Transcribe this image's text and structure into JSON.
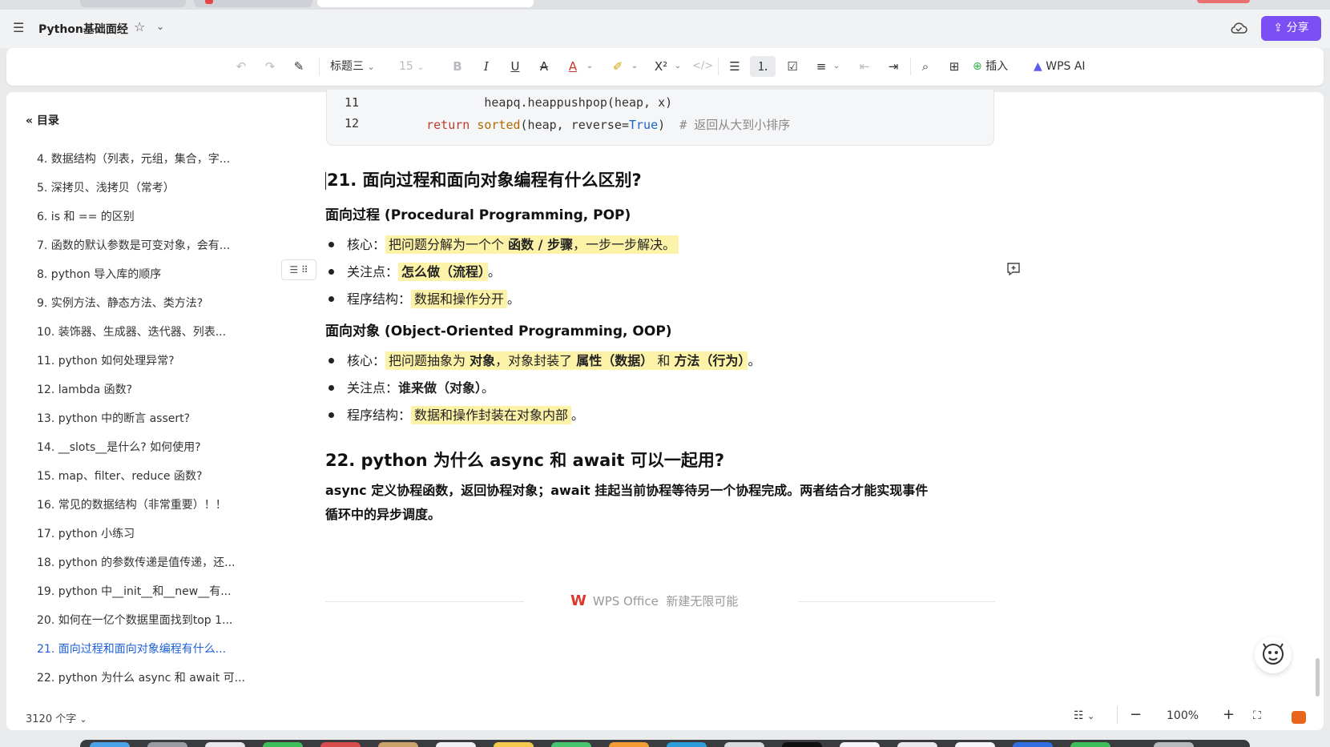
{
  "titlebar": {
    "doc_title": "Python基础面经",
    "share_label": "分享"
  },
  "toolbar": {
    "heading_style": "标题三",
    "font_size": "15",
    "insert_label": "插入",
    "ai_label": "WPS AI"
  },
  "toc": {
    "title": "目录",
    "items": [
      "4.  数据结构（列表，元组，集合，字...",
      "5.  深拷贝、浅拷贝（常考）",
      "6.  is 和 == 的区别",
      "7.  函数的默认参数是可变对象，会有...",
      "8.  python 导入库的顺序",
      "9.  实例方法、静态方法、类方法?",
      "10.  装饰器、生成器、迭代器、列表...",
      "11.  python 如何处理异常?",
      "12.  lambda 函数?",
      "13.  python 中的断言 assert?",
      "14.  __slots__是什么? 如何使用?",
      "15.  map、filter、reduce 函数?",
      "16.  常见的数据结构（非常重要）！！",
      "17.  python 小练习",
      "18.  python 的参数传递是值传递，还...",
      "19.  python 中__init__和__new__有...",
      "20.  如何在一亿个数据里面找到top 1...",
      "21.  面向过程和面向对象编程有什么...",
      "22.  python 为什么 async 和 await 可..."
    ],
    "active_index": 17
  },
  "code": {
    "lines": [
      {
        "num": "11",
        "indent": "            ",
        "parts": [
          [
            "",
            "heapq.heappushpop(heap, x)"
          ]
        ]
      },
      {
        "num": "12",
        "indent": "    ",
        "parts": [
          [
            "kw",
            "return "
          ],
          [
            "fn",
            "sorted"
          ],
          [
            "",
            "(heap, reverse="
          ],
          [
            "bi",
            "True"
          ],
          [
            "",
            ")  "
          ],
          [
            "cm",
            "# 返回从大到小排序"
          ]
        ]
      }
    ]
  },
  "section21": {
    "heading": "21. 面向过程和面向对象编程有什么区别?",
    "pop_title": "面向过程 (Procedural Programming, POP)",
    "pop_core_label": "核心：",
    "pop_core_text": "把问题分解为一个个 ",
    "pop_core_bold": "函数 / 步骤",
    "pop_core_tail": "，一步一步解决。",
    "pop_focus_label": "关注点：",
    "pop_focus_text": "怎么做（流程）",
    "pop_focus_tail": "。",
    "pop_struct_label": "程序结构：",
    "pop_struct_text": "数据和操作分开",
    "pop_struct_tail": "。",
    "oop_title": "面向对象 (Object-Oriented Programming, OOP)",
    "oop_core_label": "核心：",
    "oop_core_pre": "把问题抽象为 ",
    "oop_core_b1": "对象",
    "oop_core_mid": "，对象封装了 ",
    "oop_core_b2": "属性（数据）",
    "oop_core_and": " 和 ",
    "oop_core_b3": "方法（行为）",
    "oop_core_tail": "。",
    "oop_focus_label": "关注点：",
    "oop_focus_text": "谁来做（对象）",
    "oop_focus_tail": "。",
    "oop_struct_label": "程序结构：",
    "oop_struct_text": "数据和操作封装在对象内部",
    "oop_struct_tail": "。"
  },
  "section22": {
    "heading": "22. python 为什么 async 和 await 可以一起用?",
    "para_line1": "async 定义协程函数，返回协程对象；await 挂起当前协程等待另一个协程完成。两者结合才能实现事件",
    "para_line2": "循环中的异步调度。"
  },
  "footer": {
    "brand_logo": "W",
    "brand_name": "WPS Office",
    "brand_slogan": "新建无限可能"
  },
  "status": {
    "word_count": "3120 个字",
    "zoom": "100%"
  },
  "colors": {
    "accent": "#7c4ff4",
    "toc_active": "#1d5fd6",
    "highlight": "#fdf3a8",
    "brand_red": "#e0352b"
  }
}
